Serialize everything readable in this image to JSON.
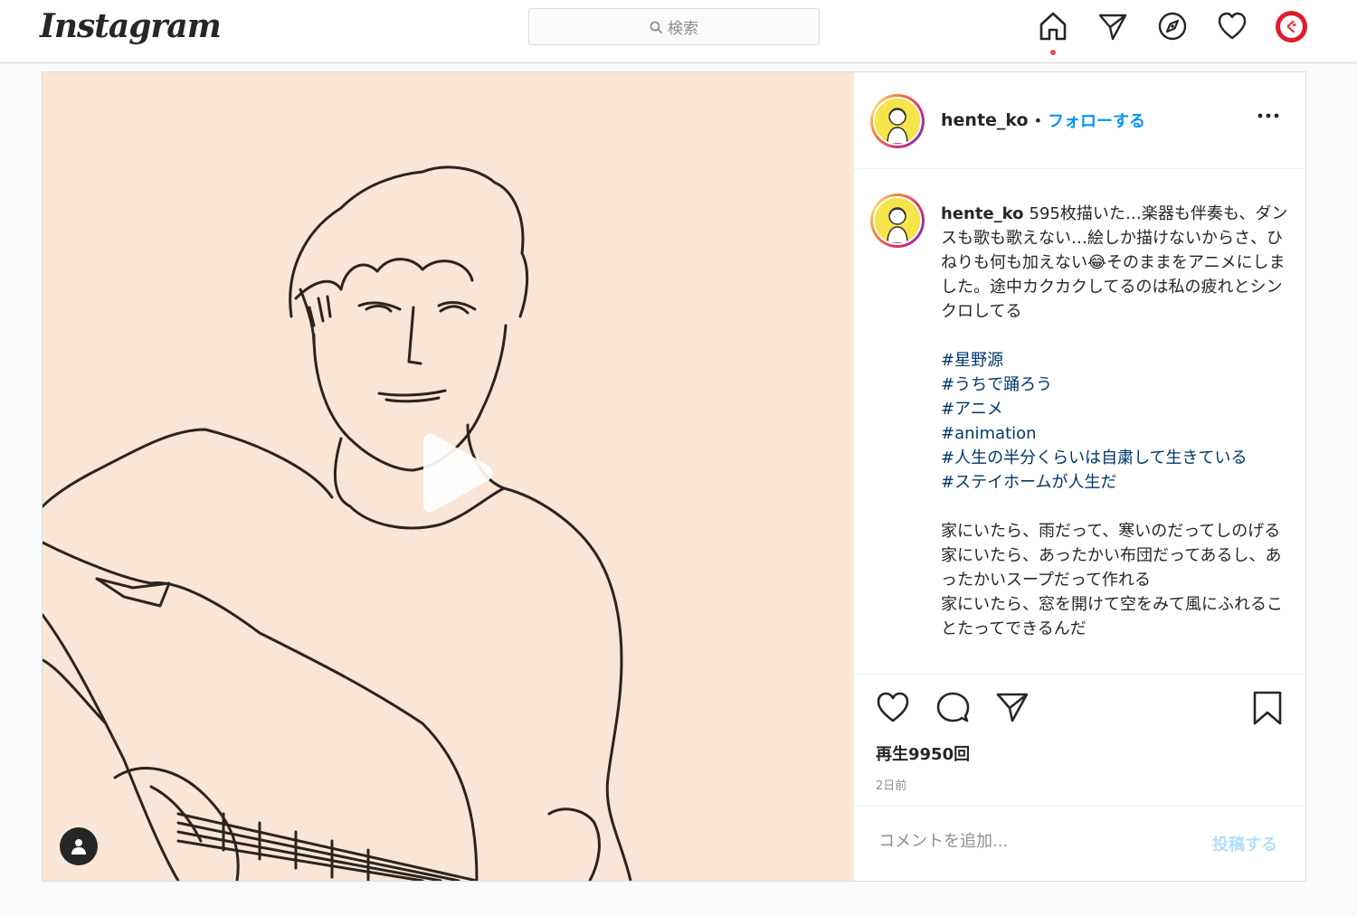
{
  "topbar": {
    "logo": "Instagram",
    "search_placeholder": "検索",
    "nav_icons": [
      "home-icon",
      "direct-icon",
      "explore-icon",
      "activity-heart-icon",
      "profile-avatar"
    ],
    "avatar_glyph": "ぐ"
  },
  "post": {
    "author": "hente_ko",
    "separator": "•",
    "follow_label": "フォローする",
    "more_icon": "ellipsis-icon",
    "caption": {
      "username": "hente_ko",
      "intro": "595枚描いた…楽器も伴奏も、ダンスも歌も歌えない…絵しか描けないからさ、ひねりも何も加えない😂そのままをアニメにしました。途中カクカクしてるのは私の疲れとシンクロしてる",
      "hashtags": [
        "#星野源",
        "#うちで踊ろう",
        "#アニメ",
        "#animation",
        "#人生の半分くらいは自粛して生きている",
        "#ステイホームが人生だ"
      ],
      "body": [
        "家にいたら、雨だって、寒いのだってしのげる",
        "家にいたら、あったかい布団だってあるし、あったかいスープだって作れる",
        "家にいたら、窓を開けて空をみて風にふれることたってできるんだ"
      ]
    },
    "actions": [
      "like-heart-icon",
      "comment-icon",
      "share-icon",
      "bookmark-icon"
    ],
    "views": "再生9950回",
    "time_ago": "2日前",
    "comment_placeholder": "コメントを追加...",
    "post_button": "投稿する",
    "colors": {
      "accent": "#0095f6",
      "hashtag": "#00376b",
      "media_background": "#f9e6d6",
      "notification_dot": "#ed4956",
      "post_button_disabled": "#b2dffc"
    }
  }
}
